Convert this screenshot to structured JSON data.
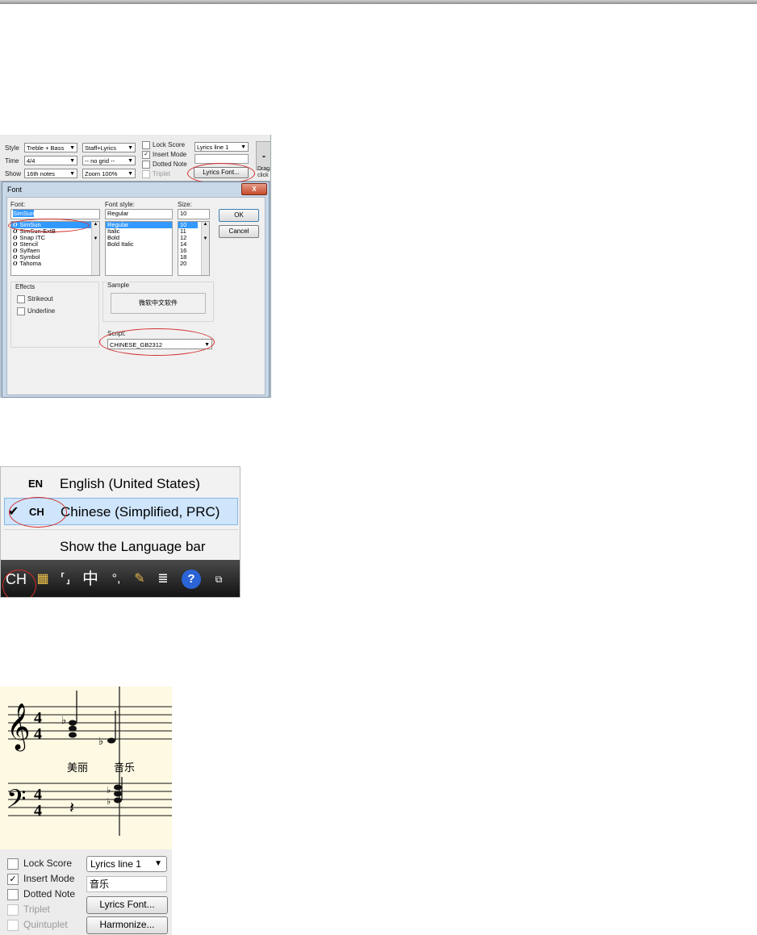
{
  "toolbar": {
    "style_label": "Style",
    "style_value": "Treble + Bass",
    "time_label": "Time",
    "time_value": "4/4",
    "show_label": "Show",
    "show_value": "16th notes",
    "staff_value": "Staff+Lyrics",
    "grid_value": "-- no grid --",
    "zoom_value": "Zoom 100%",
    "lock_score": "Lock Score",
    "insert_mode": "Insert Mode",
    "dotted_note": "Dotted Note",
    "triplet": "Triplet",
    "lyrics_line": "Lyrics line 1",
    "lyrics_font_btn": "Lyrics Font...",
    "drag_text": "Drag",
    "click_text": "click"
  },
  "font_dialog": {
    "title": "Font",
    "close": "X",
    "font_label": "Font:",
    "font_value": "SimSun",
    "fonts": [
      "SimSun",
      "SimSun-ExtB",
      "Snap ITC",
      "Stencil",
      "Sylfaen",
      "Symbol",
      "Tahoma"
    ],
    "style_label": "Font style:",
    "style_value": "Regular",
    "styles": [
      "Regular",
      "Italic",
      "Bold",
      "Bold Italic"
    ],
    "size_label": "Size:",
    "size_value": "10",
    "sizes": [
      "10",
      "11",
      "12",
      "14",
      "16",
      "18",
      "20"
    ],
    "ok": "OK",
    "cancel": "Cancel",
    "effects_label": "Effects",
    "strikeout": "Strikeout",
    "underline": "Underline",
    "sample_label": "Sample",
    "sample_text": "微软中文软件",
    "script_label": "Script:",
    "script_value": "CHINESE_GB2312"
  },
  "language_menu": {
    "items": [
      {
        "code": "EN",
        "label": "English (United States)"
      },
      {
        "code": "CH",
        "label": "Chinese (Simplified, PRC)"
      }
    ],
    "show_bar": "Show the Language bar",
    "taskbar_code": "CH",
    "taskbar_icons": [
      "ime-icon",
      "pen-icon",
      "input-mode-icon",
      "full-width-icon",
      "punctuation-icon",
      "soft-keyboard-icon",
      "notes-icon",
      "help-icon",
      "options-icon"
    ],
    "zh_char": "中",
    "punct": "°,",
    "help": "?"
  },
  "score": {
    "lyric1": "美丽",
    "lyric2": "音乐",
    "panel": {
      "lock_score": "Lock Score",
      "insert_mode": "Insert Mode",
      "dotted_note": "Dotted Note",
      "triplet": "Triplet",
      "quintuplet": "Quintuplet",
      "lyrics_line": "Lyrics line 1",
      "lyrics_text": "音乐",
      "lyrics_font_btn": "Lyrics Font...",
      "harmonize_btn": "Harmonize..."
    }
  }
}
